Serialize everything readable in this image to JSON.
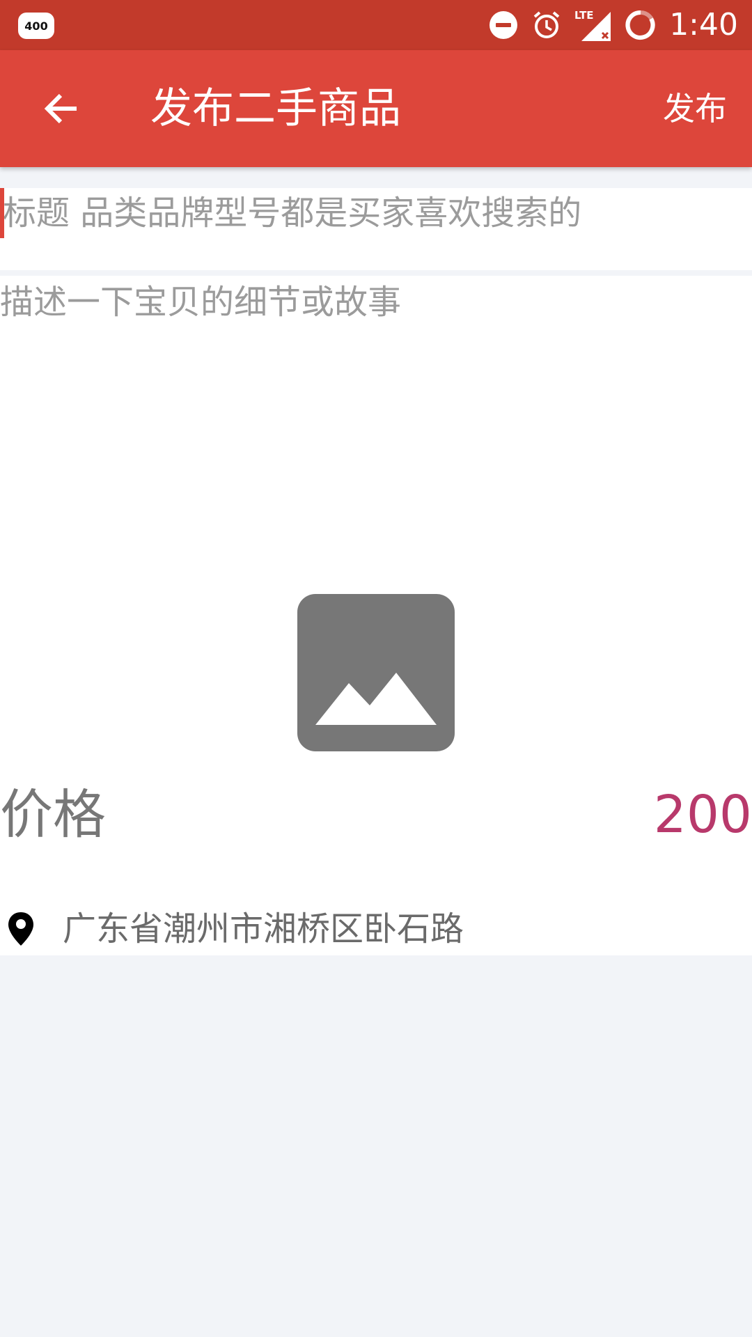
{
  "status_bar": {
    "badge": "400",
    "time": "1:40",
    "icons": [
      "do-not-disturb-icon",
      "alarm-icon",
      "lte-signal-icon",
      "battery-charging-icon"
    ]
  },
  "app_bar": {
    "title": "发布二手商品",
    "publish_label": "发布",
    "back_icon": "back-arrow-icon"
  },
  "form": {
    "title_placeholder": "标题 品类品牌型号都是买家喜欢搜索的",
    "description_placeholder": "描述一下宝贝的细节或故事",
    "image_icon": "image-placeholder-icon",
    "price_label": "价格",
    "price_value": "200",
    "location_icon": "location-pin-icon",
    "location": "广东省潮州市湘桥区卧石路"
  },
  "colors": {
    "status_bar": "#c23a2b",
    "app_bar": "#dd463b",
    "price": "#b8396b",
    "background": "#f2f4f8"
  }
}
